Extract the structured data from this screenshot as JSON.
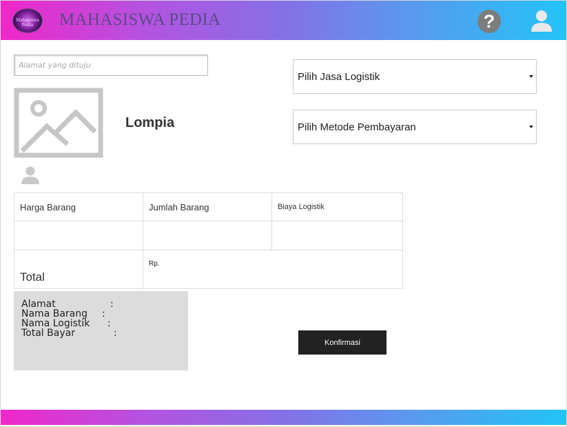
{
  "header": {
    "logo_icon": "university-logo-icon",
    "logo_text": "Mahasiswa Pedia",
    "title": "MAHASISWA PEDIA",
    "help_icon": "question-circle-icon",
    "help_glyph": "?",
    "user_icon": "user-avatar-icon"
  },
  "address": {
    "placeholder": "Alamat yang dituju",
    "value": ""
  },
  "logistics_select": {
    "selected": "Pilih Jasa Logistik"
  },
  "payment_select": {
    "selected": "Pilih Metode Pembayaran"
  },
  "product": {
    "image_icon": "image-placeholder-icon",
    "name": "Lompia",
    "seller_icon": "user-icon"
  },
  "cost_table": {
    "headers": [
      "Harga Barang",
      "Jumlah Barang",
      "Biaya Logistik"
    ],
    "row_values": [
      "",
      "",
      ""
    ],
    "total_label": "Total",
    "total_value": "Rp."
  },
  "summary": {
    "rows": [
      {
        "label": "Alamat",
        "colon": ":"
      },
      {
        "label": "Nama Barang",
        "colon": ":"
      },
      {
        "label": "Nama Logistik",
        "colon": ":"
      },
      {
        "label": "Total Bayar",
        "colon": ":"
      }
    ]
  },
  "actions": {
    "confirm_label": "Konfirmasi"
  },
  "colors": {
    "gradient_start": "#f027c9",
    "gradient_end": "#22c4f6",
    "button_bg": "#222222",
    "summary_bg": "#dcdcdc"
  }
}
